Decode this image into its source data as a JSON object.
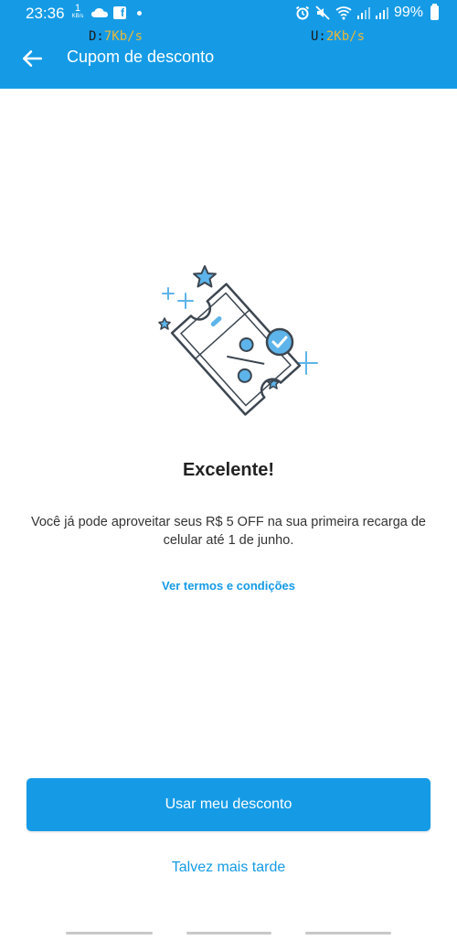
{
  "status_bar": {
    "time": "23:36",
    "net_rate_value": "1",
    "net_rate_unit": "KB/s",
    "battery": "99%"
  },
  "speed_overlay": {
    "download_label": "D:",
    "download_value": "7Kb/s",
    "upload_label": "U:",
    "upload_value": "2Kb/s"
  },
  "app_bar": {
    "title": "Cupom de desconto",
    "back_icon": "arrow-left-icon"
  },
  "content": {
    "headline": "Excelente!",
    "description": "Você já pode aproveitar seus R$ 5 OFF na sua primeira recarga de celular até 1 de junho.",
    "terms_link": "Ver termos e condições",
    "primary_button": "Usar meu desconto",
    "secondary_button": "Talvez mais tarde"
  },
  "colors": {
    "brand_blue": "#159be6",
    "text_dark": "#222222",
    "illustration_blue": "#5db4ea",
    "illustration_stroke": "#3c4650"
  }
}
